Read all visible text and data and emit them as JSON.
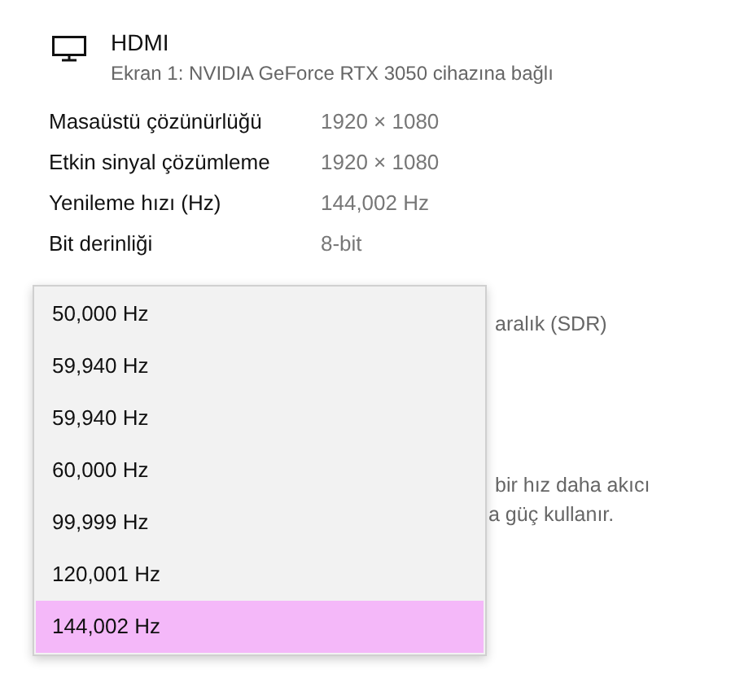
{
  "header": {
    "title": "HDMI",
    "subtitle": "Ekran 1: NVIDIA GeForce RTX 3050 cihazına bağlı"
  },
  "properties": [
    {
      "label": "Masaüstü çözünürlüğü",
      "value": "1920 × 1080"
    },
    {
      "label": "Etkin sinyal çözümleme",
      "value": "1920 × 1080"
    },
    {
      "label": "Yenileme hızı (Hz)",
      "value": "144,002 Hz"
    },
    {
      "label": "Bit derinliği",
      "value": "8-bit"
    }
  ],
  "partly_covered_texts": [
    "aralık (SDR)",
    "bir hız daha akıcı",
    "a güç kullanır."
  ],
  "dropdown": {
    "options": [
      {
        "label": "50,000 Hz",
        "selected": false
      },
      {
        "label": "59,940 Hz",
        "selected": false
      },
      {
        "label": "59,940 Hz",
        "selected": false
      },
      {
        "label": "60,000 Hz",
        "selected": false
      },
      {
        "label": "99,999 Hz",
        "selected": false
      },
      {
        "label": "120,001 Hz",
        "selected": false
      },
      {
        "label": "144,002 Hz",
        "selected": true
      }
    ]
  }
}
